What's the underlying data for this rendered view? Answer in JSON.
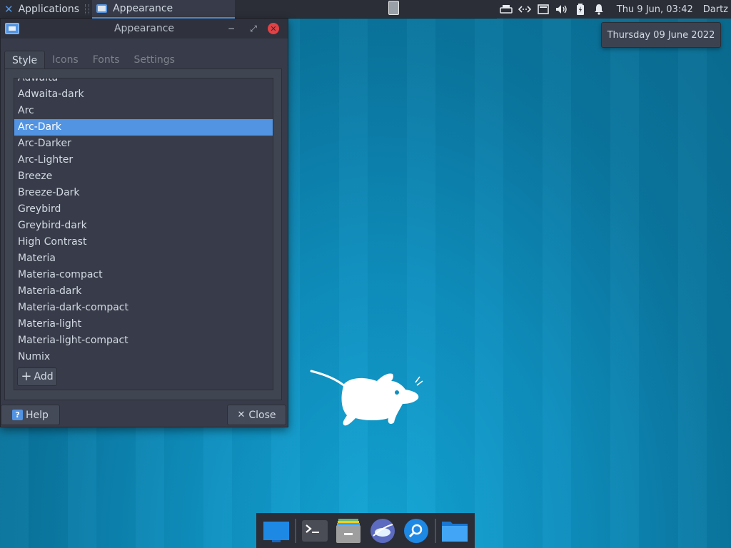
{
  "top_panel": {
    "applications_label": "Applications",
    "task_title": "Appearance",
    "clock": "Thu  9 Jun, 03:42",
    "user": "Dartz"
  },
  "date_tooltip": "Thursday 09 June 2022",
  "window": {
    "title": "Appearance",
    "tabs": [
      {
        "label": "Style",
        "active": true
      },
      {
        "label": "Icons",
        "active": false
      },
      {
        "label": "Fonts",
        "active": false
      },
      {
        "label": "Settings",
        "active": false
      }
    ],
    "themes": [
      "Adwaita",
      "Adwaita-dark",
      "Arc",
      "Arc-Dark",
      "Arc-Darker",
      "Arc-Lighter",
      "Breeze",
      "Breeze-Dark",
      "Greybird",
      "Greybird-dark",
      "High Contrast",
      "Materia",
      "Materia-compact",
      "Materia-dark",
      "Materia-dark-compact",
      "Materia-light",
      "Materia-light-compact",
      "Numix"
    ],
    "selected_theme": "Arc-Dark",
    "add_label": "Add",
    "help_label": "Help",
    "close_label": "Close"
  },
  "dock": {
    "items": [
      "desktop-icon",
      "terminal-icon",
      "file-manager-icon",
      "web-browser-icon",
      "app-finder-icon",
      "folder-icon"
    ]
  },
  "colors": {
    "accent": "#5294e2",
    "panel": "#2b2e37",
    "window_bg": "#383c4a",
    "close_red": "#e14245",
    "wallpaper": "#0e8fbf"
  }
}
